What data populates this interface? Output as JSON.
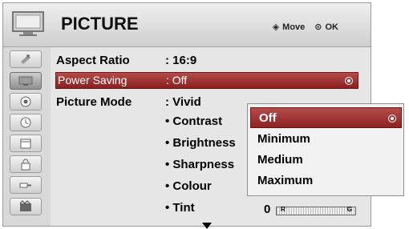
{
  "header": {
    "title": "PICTURE",
    "hint_move": "Move",
    "hint_ok": "OK"
  },
  "sidebar": {
    "items": [
      {
        "icon": "satellite-icon"
      },
      {
        "icon": "tv-icon"
      },
      {
        "icon": "speaker-icon"
      },
      {
        "icon": "clock-icon"
      },
      {
        "icon": "calendar-icon"
      },
      {
        "icon": "lock-icon"
      },
      {
        "icon": "input-plug-icon"
      },
      {
        "icon": "media-icon"
      }
    ]
  },
  "menu": {
    "rows": [
      {
        "label": "Aspect Ratio",
        "value": ": 16:9"
      },
      {
        "label": "Power Saving",
        "value": ": Off"
      },
      {
        "label": "Picture Mode",
        "value": ": Vivid"
      }
    ],
    "sub_rows": [
      "• Contrast",
      "• Brightness",
      "• Sharpness",
      "• Colour",
      "• Tint"
    ],
    "tint_value": "0",
    "tint_bar": {
      "left": "R",
      "right": "G",
      "level": 0.5
    }
  },
  "submenu": {
    "selected": "Off",
    "items": [
      "Off",
      "Minimum",
      "Medium",
      "Maximum"
    ]
  },
  "colors": {
    "accent_red": "#9b2e2e",
    "panel_gray": "#d9d9d9",
    "content_gray": "#e6e6e6"
  }
}
